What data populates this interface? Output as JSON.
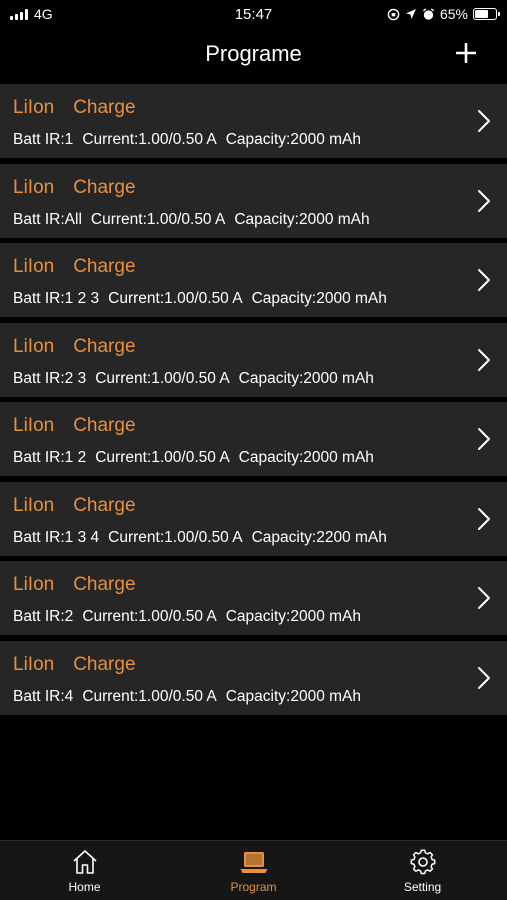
{
  "status_bar": {
    "network": "4G",
    "time": "15:47",
    "battery_percent": "65%",
    "battery_level": 0.65
  },
  "header": {
    "title": "Programe",
    "add_icon": "plus-icon"
  },
  "programs": [
    {
      "type": "LiIon",
      "mode": "Charge",
      "batt_ir": "Batt IR:1",
      "current": "Current:1.00/0.50 A",
      "capacity": "Capacity:2000 mAh"
    },
    {
      "type": "LiIon",
      "mode": "Charge",
      "batt_ir": "Batt IR:All",
      "current": "Current:1.00/0.50 A",
      "capacity": "Capacity:2000 mAh"
    },
    {
      "type": "LiIon",
      "mode": "Charge",
      "batt_ir": "Batt IR:1 2 3",
      "current": "Current:1.00/0.50 A",
      "capacity": "Capacity:2000 mAh"
    },
    {
      "type": "LiIon",
      "mode": "Charge",
      "batt_ir": "Batt IR:2 3",
      "current": "Current:1.00/0.50 A",
      "capacity": "Capacity:2000 mAh"
    },
    {
      "type": "LiIon",
      "mode": "Charge",
      "batt_ir": "Batt IR:1 2",
      "current": "Current:1.00/0.50 A",
      "capacity": "Capacity:2000 mAh"
    },
    {
      "type": "LiIon",
      "mode": "Charge",
      "batt_ir": "Batt IR:1 3 4",
      "current": "Current:1.00/0.50 A",
      "capacity": "Capacity:2200 mAh"
    },
    {
      "type": "LiIon",
      "mode": "Charge",
      "batt_ir": "Batt IR:2",
      "current": "Current:1.00/0.50 A",
      "capacity": "Capacity:2000 mAh"
    },
    {
      "type": "LiIon",
      "mode": "Charge",
      "batt_ir": "Batt IR:4",
      "current": "Current:1.00/0.50 A",
      "capacity": "Capacity:2000 mAh"
    }
  ],
  "tab_bar": {
    "tabs": [
      {
        "label": "Home",
        "icon": "home-icon"
      },
      {
        "label": "Program",
        "icon": "laptop-icon"
      },
      {
        "label": "Setting",
        "icon": "gear-icon"
      }
    ],
    "active_tab": "Program"
  },
  "colors": {
    "accent": "#e8903c",
    "row_background": "#262626",
    "page_background": "#000000"
  }
}
